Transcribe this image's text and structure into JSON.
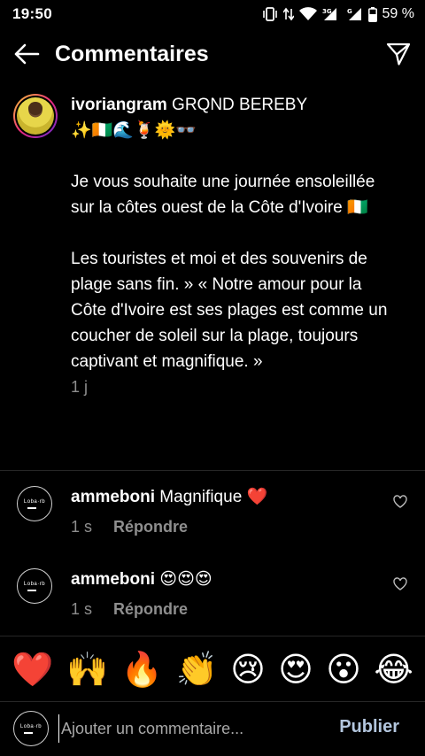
{
  "status_bar": {
    "time": "19:50",
    "network": "3G",
    "battery": "59 %",
    "icons": [
      "vibrate-icon",
      "data-arrows-icon",
      "wifi-icon",
      "signal-icon",
      "signal-icon-2",
      "battery-icon"
    ]
  },
  "header": {
    "title": "Commentaires",
    "back_icon": "arrow-left-icon",
    "share_icon": "send-icon"
  },
  "caption": {
    "username": "ivoriangram",
    "first_line": " GRQND BEREBY",
    "emojis": "✨🇨🇮🌊🍹🌞👓",
    "paragraph_1": "Je vous souhaite une journée ensoleillée sur la côtes ouest de la Côte d'Ivoire 🇨🇮",
    "paragraph_2": "Les touristes et moi et des souvenirs de plage sans fin. » « Notre amour pour la Côte d'Ivoire est ses plages est comme un coucher de soleil sur la plage, toujours captivant et magnifique. »",
    "time": "1 j"
  },
  "comments": [
    {
      "username": "ammeboni",
      "text": " Magnifique ❤️",
      "time": "1 s",
      "reply": "Répondre",
      "avatar_text": "Loba·rb"
    },
    {
      "username": "ammeboni",
      "text": " 😍😍😍",
      "time": "1 s",
      "reply": "Répondre",
      "avatar_text": "Loba·rb"
    }
  ],
  "emoji_bar": [
    "❤️",
    "🙌",
    "🔥",
    "👏",
    "😢",
    "😍",
    "😮",
    "😂"
  ],
  "input": {
    "placeholder": "Ajouter un commentaire...",
    "publish_label": "Publier",
    "avatar_text": "Loba·rb"
  },
  "colors": {
    "background": "#000000",
    "secondary_text": "#8e8e8e",
    "publish_disabled": "#b3c6de",
    "divider": "#262626"
  }
}
